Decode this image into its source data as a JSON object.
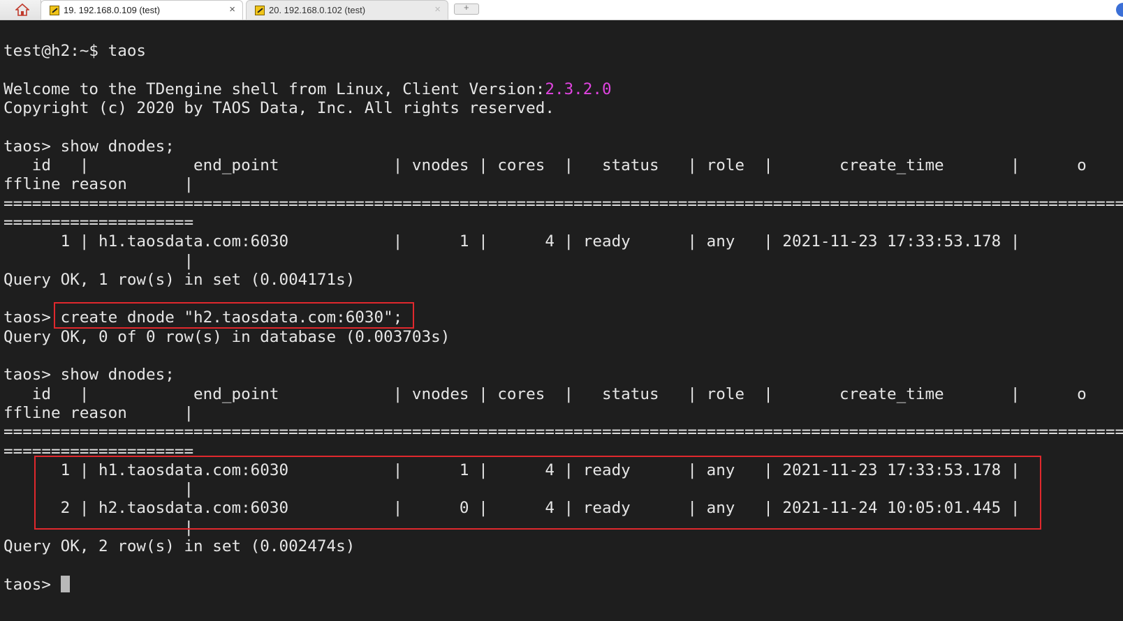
{
  "tabs": [
    {
      "label": "19. 192.168.0.109 (test)",
      "close": "×",
      "active": true
    },
    {
      "label": "20. 192.168.0.102 (test)",
      "close": "×",
      "active": false
    }
  ],
  "icons": {
    "home": "home-icon",
    "session": "terminal-session-icon",
    "new_tab": "add-tab-icon"
  },
  "colors": {
    "background": "#1e1e1e",
    "text": "#e6e6e6",
    "version": "#e044e0",
    "highlight": "#e0282d"
  },
  "terminal": {
    "lines": [
      "",
      "test@h2:~$ taos",
      "",
      "Welcome to the TDengine shell from Linux, Client Version:",
      "Copyright (c) 2020 by TAOS Data, Inc. All rights reserved.",
      "",
      "taos> show dnodes;",
      "   id   |           end_point            | vnodes | cores  |   status   | role  |       create_time       |      o",
      "ffline reason      |",
      "=========================================================================================================================",
      "====================",
      "      1 | h1.taosdata.com:6030           |      1 |      4 | ready      | any   | 2021-11-23 17:33:53.178 |",
      "                   |",
      "Query OK, 1 row(s) in set (0.004171s)",
      "",
      "taos> create dnode \"h2.taosdata.com:6030\";",
      "Query OK, 0 of 0 row(s) in database (0.003703s)",
      "",
      "taos> show dnodes;",
      "   id   |           end_point            | vnodes | cores  |   status   | role  |       create_time       |      o",
      "ffline reason      |",
      "=========================================================================================================================",
      "====================",
      "      1 | h1.taosdata.com:6030           |      1 |      4 | ready      | any   | 2021-11-23 17:33:53.178 |",
      "                   |",
      "      2 | h2.taosdata.com:6030           |      0 |      4 | ready      | any   | 2021-11-24 10:05:01.445 |",
      "                   |",
      "Query OK, 2 row(s) in set (0.002474s)",
      "",
      "taos> "
    ],
    "client_version": "2.3.2.0"
  }
}
